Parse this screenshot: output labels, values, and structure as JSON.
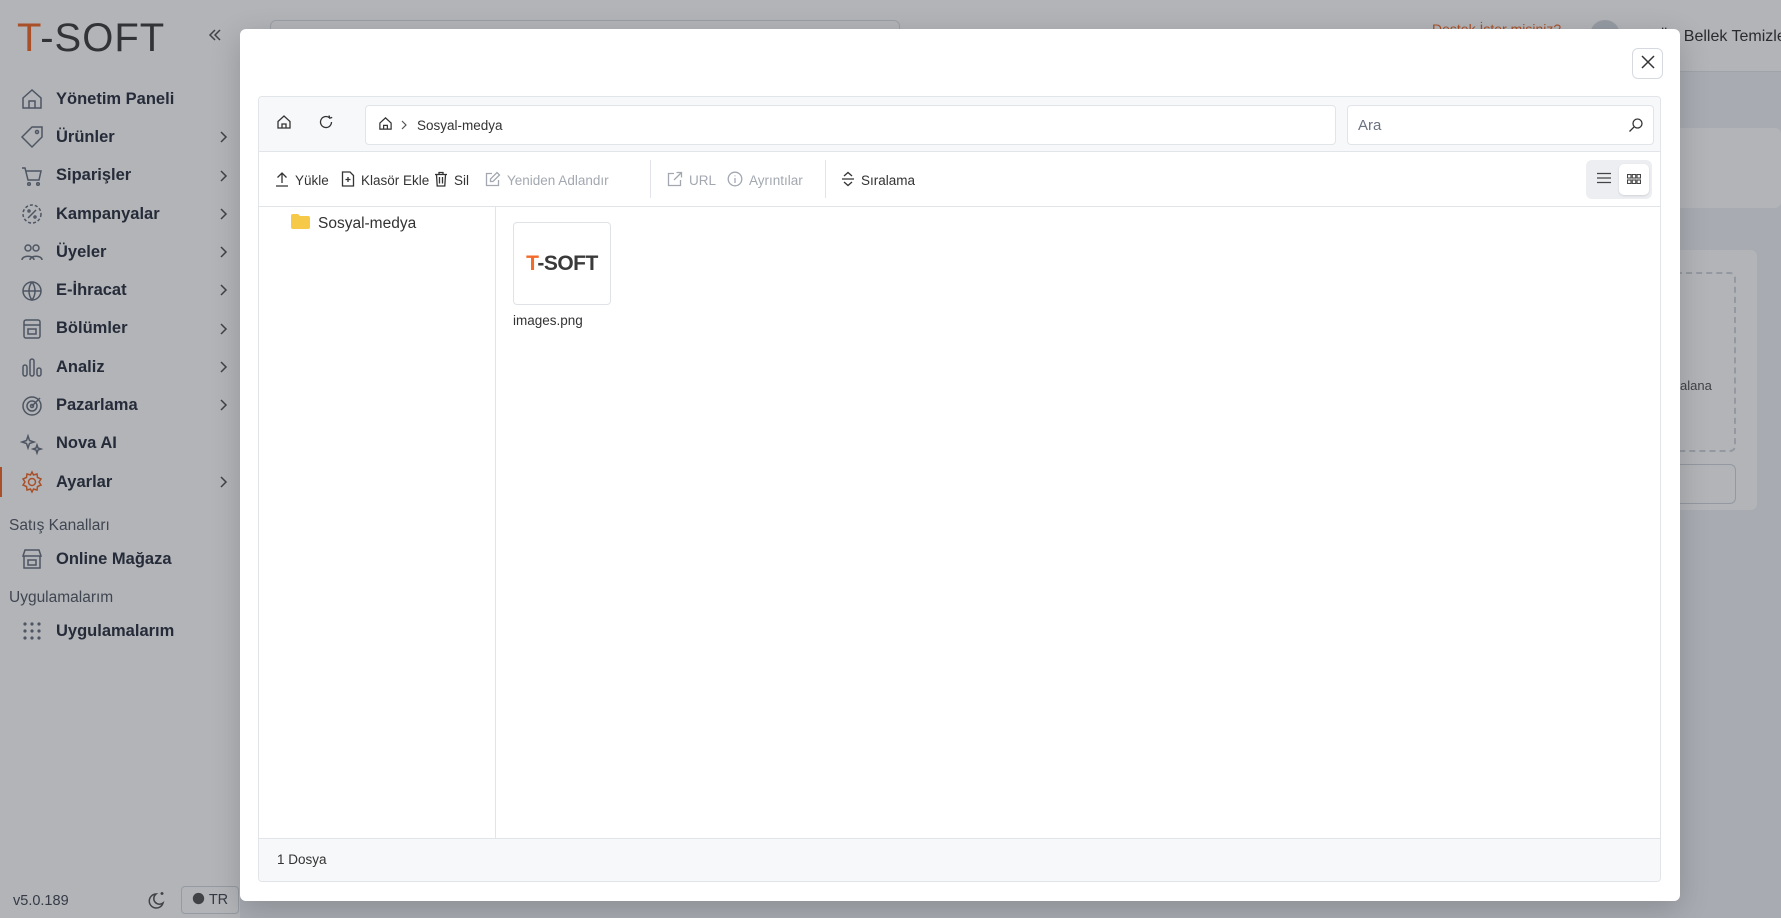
{
  "app": {
    "logo_prefix": "T",
    "logo_rest": "-SOFT",
    "brand_color": "#f26b2a"
  },
  "sidebar": {
    "items": [
      {
        "label": "Yönetim Paneli",
        "icon": "home-icon",
        "has_submenu": false
      },
      {
        "label": "Ürünler",
        "icon": "tag-icon",
        "has_submenu": true
      },
      {
        "label": "Siparişler",
        "icon": "cart-icon",
        "has_submenu": true
      },
      {
        "label": "Kampanyalar",
        "icon": "discount-icon",
        "has_submenu": true
      },
      {
        "label": "Üyeler",
        "icon": "users-icon",
        "has_submenu": true
      },
      {
        "label": "E-İhracat",
        "icon": "globe-icon",
        "has_submenu": true
      },
      {
        "label": "Bölümler",
        "icon": "layout-icon",
        "has_submenu": true
      },
      {
        "label": "Analiz",
        "icon": "chart-icon",
        "has_submenu": true
      },
      {
        "label": "Pazarlama",
        "icon": "target-icon",
        "has_submenu": true
      },
      {
        "label": "Nova AI",
        "icon": "sparkle-icon",
        "has_submenu": false
      },
      {
        "label": "Ayarlar",
        "icon": "gear-icon",
        "has_submenu": true,
        "active": true
      }
    ],
    "sections": [
      {
        "title": "Satış Kanalları",
        "items": [
          {
            "label": "Online Mağaza",
            "icon": "store-icon"
          }
        ]
      },
      {
        "title": "Uygulamalarım",
        "items": [
          {
            "label": "Uygulamalarım",
            "icon": "apps-grid-icon"
          }
        ]
      }
    ],
    "version": "v5.0.189",
    "language": "TR"
  },
  "topbar": {
    "help_text": "Destek İster misiniz?",
    "cache_button": "Ön Bellek Temizle"
  },
  "background_page": {
    "dropzone_label": "alana"
  },
  "file_manager": {
    "breadcrumb": {
      "current": "Sosyal-medya"
    },
    "search": {
      "placeholder": "Ara",
      "value": ""
    },
    "toolbar": {
      "upload": "Yükle",
      "add_folder": "Klasör Ekle",
      "delete": "Sil",
      "rename": "Yeniden Adlandır",
      "url": "URL",
      "details": "Ayrıntılar",
      "sort": "Sıralama"
    },
    "view_mode": "grid",
    "tree": [
      {
        "name": "Sosyal-medya",
        "icon": "folder-icon"
      }
    ],
    "files": [
      {
        "name": "images.png",
        "thumbnail_text_prefix": "T",
        "thumbnail_text_rest": "-SOFT"
      }
    ],
    "status": "1 Dosya"
  }
}
